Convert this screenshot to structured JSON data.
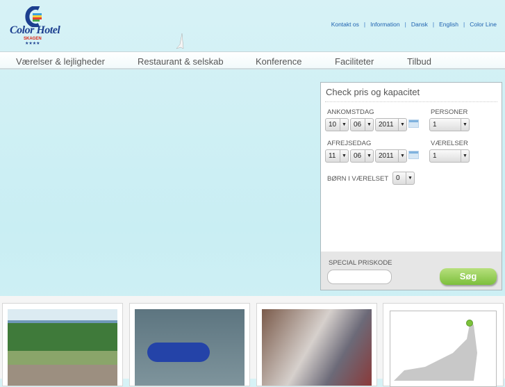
{
  "logo": {
    "name": "Color Hotel",
    "location": "SKAGEN",
    "stars": "★★★★"
  },
  "top_links": [
    "Kontakt os",
    "Information",
    "Dansk",
    "English",
    "Color Line"
  ],
  "nav": [
    "Værelser & lejligheder",
    "Restaurant & selskab",
    "Konference",
    "Faciliteter",
    "Tilbud"
  ],
  "booking": {
    "title": "Check pris og kapacitet",
    "arrival_label": "ANKOMSTDAG",
    "arrival": {
      "day": "10",
      "month": "06",
      "year": "2011"
    },
    "departure_label": "AFREJSEDAG",
    "departure": {
      "day": "11",
      "month": "06",
      "year": "2011"
    },
    "persons_label": "PERSONER",
    "persons": "1",
    "rooms_label": "VÆRELSER",
    "rooms": "1",
    "children_label": "BØRN I VÆRELSET",
    "children": "0",
    "code_label": "SPECIAL PRISKODE",
    "code_value": "",
    "search_label": "Søg"
  },
  "colors": {
    "accent_green": "#7cbf3c",
    "link_blue": "#1e62b0",
    "map_marker": "#7cc23a"
  }
}
